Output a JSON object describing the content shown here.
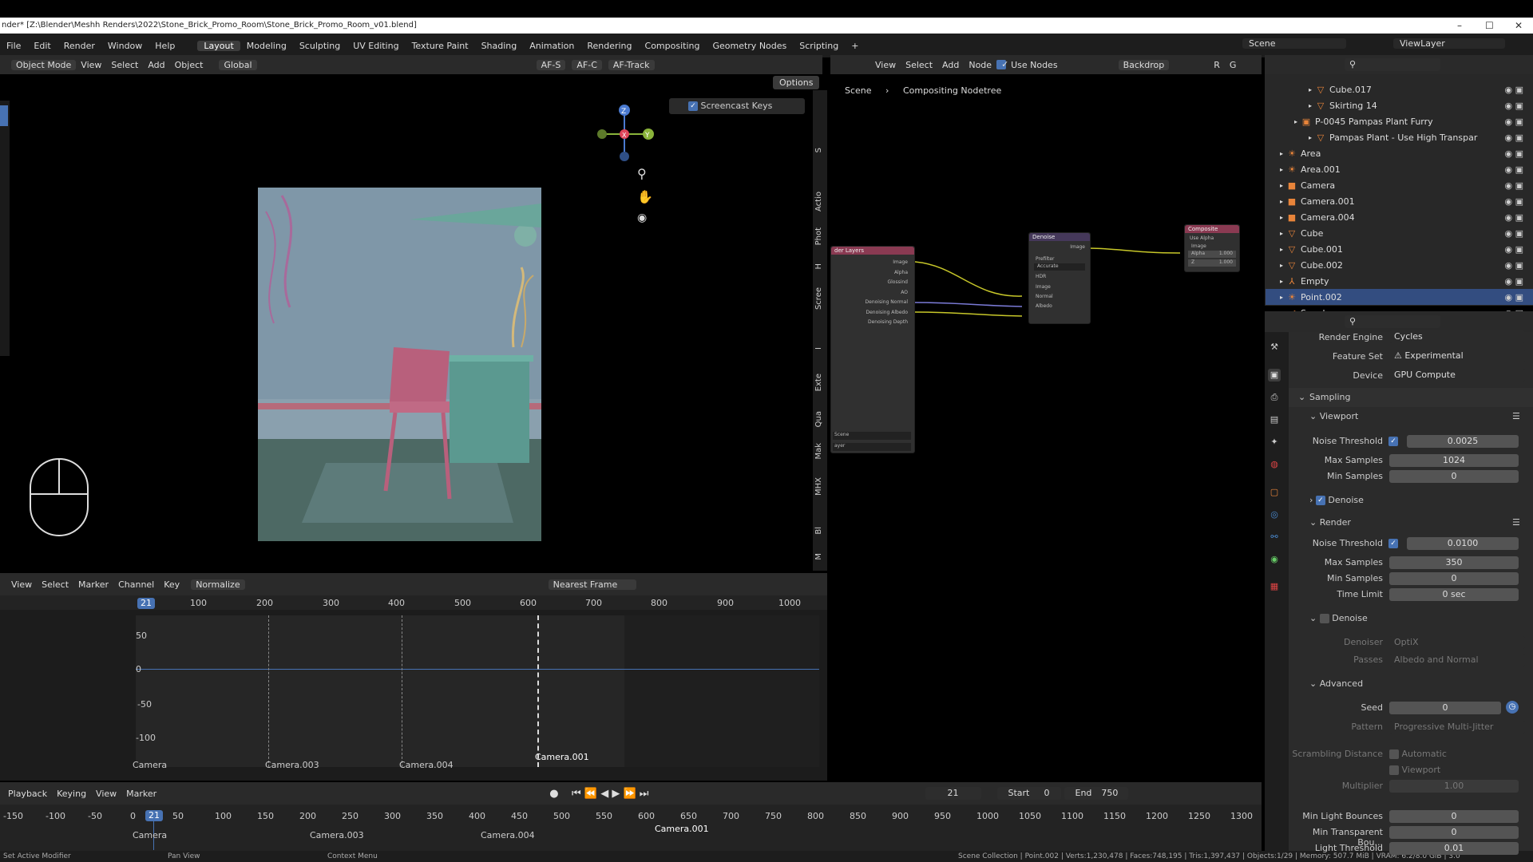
{
  "title_bar": {
    "text": "nder* [Z:\\Blender\\Meshh Renders\\2022\\Stone_Brick_Promo_Room\\Stone_Brick_Promo_Room_v01.blend]",
    "minimize": "–",
    "maximize": "☐",
    "close": "✕"
  },
  "menu": {
    "items": [
      "File",
      "Edit",
      "Render",
      "Window",
      "Help"
    ],
    "workspaces": [
      "Layout",
      "Modeling",
      "Sculpting",
      "UV Editing",
      "Texture Paint",
      "Shading",
      "Animation",
      "Rendering",
      "Compositing",
      "Geometry Nodes",
      "Scripting"
    ],
    "add": "+",
    "scene": "Scene",
    "view_layer": "ViewLayer"
  },
  "viewport": {
    "mode": "Object Mode",
    "menus": [
      "View",
      "Select",
      "Add",
      "Object"
    ],
    "orientation": "Global",
    "options": "Options",
    "af_s": "AF-S",
    "af_c": "AF-C",
    "af_track": "AF-Track",
    "screencast_keys": "Screencast Keys",
    "gizmo": {
      "x": "X",
      "y": "Y",
      "z": "Z"
    }
  },
  "side_tabs": [
    "S",
    "Actio",
    "Phot",
    "H",
    "Scree",
    "I",
    "Exte",
    "Qua",
    "Mak",
    "MHX",
    "Bl",
    "M"
  ],
  "compositor": {
    "menus": [
      "View",
      "Select",
      "Add",
      "Node"
    ],
    "use_nodes": "Use Nodes",
    "backdrop": "Backdrop",
    "breadcrumb": [
      "Scene",
      "Compositing Nodetree"
    ],
    "channel_letters": [
      "R",
      "G"
    ],
    "render_layers": {
      "title": "der Layers",
      "outputs": [
        "Image",
        "Alpha",
        "Glossind",
        "AO",
        "Denoising Normal",
        "Denoising Albedo",
        "Denoising Depth"
      ],
      "scene": "Scene",
      "layer": "ayer"
    },
    "denoise": {
      "title": "Denoise",
      "output": "Image",
      "prefilter_label": "Prefilter",
      "prefilter": "Accurate",
      "hdr": "HDR",
      "inputs": [
        "Image",
        "Normal",
        "Albedo"
      ]
    },
    "composite": {
      "title": "Composite",
      "use_alpha": "Use Alpha",
      "image": "Image",
      "alpha_label": "Alpha",
      "alpha": "1.000",
      "z_label": "Z",
      "z": "1.000"
    }
  },
  "dopesheet": {
    "menus": [
      "View",
      "Select",
      "Marker",
      "Channel",
      "Key"
    ],
    "normalize": "Normalize",
    "nearest_frame": "Nearest Frame",
    "current_frame": "21",
    "ticks": [
      "100",
      "200",
      "300",
      "400",
      "500",
      "600",
      "700",
      "800",
      "900",
      "1000"
    ],
    "y_ticks": [
      "50",
      "0",
      "-50",
      "-100"
    ],
    "markers": [
      "Camera",
      "Camera.003",
      "Camera.004",
      "Camera.001"
    ]
  },
  "timeline": {
    "menus": [
      "Playback",
      "Keying",
      "View",
      "Marker"
    ],
    "frame": "21",
    "start_label": "Start",
    "start": "0",
    "end_label": "End",
    "end": "750",
    "ticks": [
      "-150",
      "-100",
      "-50",
      "0",
      "50",
      "100",
      "150",
      "200",
      "250",
      "300",
      "350",
      "400",
      "450",
      "500",
      "550",
      "600",
      "650",
      "700",
      "750",
      "800",
      "850",
      "900",
      "950",
      "1000",
      "1050",
      "1100",
      "1150",
      "1200",
      "1250",
      "1300"
    ],
    "markers": [
      "Camera",
      "Camera.003",
      "Camera.004",
      "Camera.001"
    ]
  },
  "outliner": {
    "items": [
      {
        "name": "Cube.017",
        "indent": 2,
        "icon": "▽"
      },
      {
        "name": "Skirting 14",
        "indent": 2,
        "icon": "▽"
      },
      {
        "name": "P-0045 Pampas Plant Furry",
        "indent": 1,
        "icon": "▣"
      },
      {
        "name": "Pampas Plant - Use High Transpar",
        "indent": 2,
        "icon": "▽"
      },
      {
        "name": "Area",
        "indent": 0,
        "icon": "☀"
      },
      {
        "name": "Area.001",
        "indent": 0,
        "icon": "☀"
      },
      {
        "name": "Camera",
        "indent": 0,
        "icon": "■"
      },
      {
        "name": "Camera.001",
        "indent": 0,
        "icon": "■"
      },
      {
        "name": "Camera.004",
        "indent": 0,
        "icon": "■"
      },
      {
        "name": "Cube",
        "indent": 0,
        "icon": "▽"
      },
      {
        "name": "Cube.001",
        "indent": 0,
        "icon": "▽"
      },
      {
        "name": "Cube.002",
        "indent": 0,
        "icon": "▽"
      },
      {
        "name": "Empty",
        "indent": 0,
        "icon": "⅄"
      },
      {
        "name": "Point.002",
        "indent": 0,
        "icon": "☀",
        "selected": true
      },
      {
        "name": "Speaker",
        "indent": 0,
        "icon": "◀"
      }
    ]
  },
  "properties": {
    "render_engine_label": "Render Engine",
    "render_engine": "Cycles",
    "feature_set_label": "Feature Set",
    "feature_set": "Experimental",
    "device_label": "Device",
    "device": "GPU Compute",
    "sampling": "Sampling",
    "viewport": "Viewport",
    "noise_threshold_label": "Noise Threshold",
    "viewport_noise_threshold": "0.0025",
    "max_samples_label": "Max Samples",
    "viewport_max_samples": "1024",
    "min_samples_label": "Min Samples",
    "viewport_min_samples": "0",
    "denoise": "Denoise",
    "render": "Render",
    "render_noise_threshold": "0.0100",
    "render_max_samples": "350",
    "render_min_samples": "0",
    "time_limit_label": "Time Limit",
    "time_limit": "0 sec",
    "denoiser_label": "Denoiser",
    "denoiser": "OptiX",
    "passes_label": "Passes",
    "passes": "Albedo and Normal",
    "advanced": "Advanced",
    "seed_label": "Seed",
    "seed": "0",
    "pattern_label": "Pattern",
    "pattern": "Progressive Multi-Jitter",
    "scrambling_label": "Scrambling Distance",
    "automatic": "Automatic",
    "viewport_check": "Viewport",
    "multiplier_label": "Multiplier",
    "multiplier": "1.00",
    "min_light_bounces_label": "Min Light Bounces",
    "min_light_bounces": "0",
    "min_transparent_label": "Min Transparent Bou...",
    "min_transparent": "0",
    "light_threshold_label": "Light Threshold",
    "light_threshold": "0.01"
  },
  "status": {
    "left": "Set Active Modifier",
    "pan": "Pan View",
    "context": "Context Menu",
    "right": "Scene Collection | Point.002 | Verts:1,230,478 | Faces:748,195 | Tris:1,397,437 | Objects:1/29 | Memory: 507.7 MiB | VRAM: 6.2/8.0 GiB | 3.0"
  }
}
